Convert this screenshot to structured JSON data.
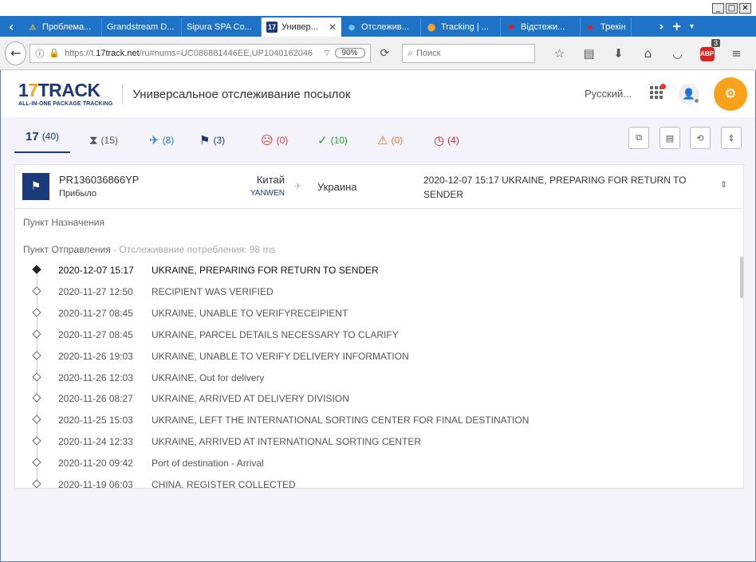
{
  "window": {
    "minimize": "_",
    "maximize": "□",
    "close": "✕"
  },
  "tabs": [
    {
      "label": "Проблема...",
      "icon": "⚠",
      "icon_color": "#f0c419"
    },
    {
      "label": "Grandstream D...",
      "icon": "",
      "icon_color": ""
    },
    {
      "label": "Sipura SPA Co...",
      "icon": "",
      "icon_color": ""
    },
    {
      "label": "Универ...",
      "icon": "17",
      "icon_color": "#1a3a7a",
      "active": true
    },
    {
      "label": "Отслежив...",
      "icon": "◉",
      "icon_color": "#7fd0ff"
    },
    {
      "label": "Tracking | ...",
      "icon": "⬤",
      "icon_color": "#f5a623"
    },
    {
      "label": "Відстежи...",
      "icon": "✱",
      "icon_color": "#e02020"
    },
    {
      "label": "Трекінг",
      "icon": "▶",
      "icon_color": "#e02020"
    }
  ],
  "tab_controls": {
    "prev": "‹",
    "next": "›",
    "new_tab": "+",
    "menu": "▾"
  },
  "navbar": {
    "back": "←",
    "url_prefix": "https://t.",
    "url_host": "17track.net",
    "url_rest": "/ru#nums=UC086881446EE,UP1040162046",
    "zoom": "90%",
    "search_placeholder": "Поиск",
    "abp_label": "ABP",
    "abp_count": "3"
  },
  "header": {
    "logo_mark": "17TRACK",
    "logo_sub": "ALL-IN-ONE PACKAGE TRACKING",
    "title": "Универсальное отслеживание посылок",
    "language": "Русский..."
  },
  "filters": [
    {
      "name": "all",
      "count": "(40)",
      "color": "#1a3a7a"
    },
    {
      "name": "not-found",
      "count": "(15)",
      "color": "#555555"
    },
    {
      "name": "in-transit",
      "count": "(8)",
      "color": "#2a7fd4"
    },
    {
      "name": "pick-up",
      "count": "(3)",
      "color": "#1a3a7a"
    },
    {
      "name": "undelivered",
      "count": "(0)",
      "color": "#e03a3a"
    },
    {
      "name": "delivered",
      "count": "(10)",
      "color": "#2a9a3a"
    },
    {
      "name": "alert",
      "count": "(0)",
      "color": "#f07a1a"
    },
    {
      "name": "expired",
      "count": "(4)",
      "color": "#c02a2a"
    }
  ],
  "package": {
    "number": "PR136036866YP",
    "status": "Прибыло",
    "origin": "Китай",
    "carrier": "YANWEN",
    "destination": "Украина",
    "latest_event": "2020-12-07 15:17 UKRAINE, PREPARING FOR RETURN TO SENDER"
  },
  "sections": {
    "destination_label": "Пункт Назначения",
    "origin_label": "Пункт Отправления",
    "origin_note": " - Отслеживание потребления: 98 ms"
  },
  "events": [
    {
      "time": "2020-12-07 15:17",
      "desc": "UKRAINE, PREPARING FOR RETURN TO SENDER"
    },
    {
      "time": "2020-11-27 12:50",
      "desc": "RECIPIENT WAS VERIFIED"
    },
    {
      "time": "2020-11-27 08:45",
      "desc": "UKRAINE, UNABLE TO VERIFYRECEIPIENT"
    },
    {
      "time": "2020-11-27 08:45",
      "desc": "UKRAINE, PARCEL DETAILS NECESSARY TO CLARIFY"
    },
    {
      "time": "2020-11-26 19:03",
      "desc": "UKRAINE, UNABLE TO VERIFY DELIVERY INFORMATION"
    },
    {
      "time": "2020-11-26 12:03",
      "desc": "UKRAINE, Out for delivery"
    },
    {
      "time": "2020-11-26 08:27",
      "desc": "UKRAINE, ARRIVED AT DELIVERY DIVISION"
    },
    {
      "time": "2020-11-25 15:03",
      "desc": "UKRAINE, LEFT THE INTERNATIONAL SORTING CENTER FOR FINAL DESTINATION"
    },
    {
      "time": "2020-11-24 12:33",
      "desc": "UKRAINE, ARRIVED AT INTERNATIONAL SORTING CENTER"
    },
    {
      "time": "2020-11-20 09:42",
      "desc": "Port of destination - Arrival"
    },
    {
      "time": "2020-11-19 06:03",
      "desc": "CHINA, REGISTER COLLECTED"
    }
  ],
  "colors": {
    "brand": "#1a3a7a",
    "accent": "#f7a21b",
    "tabstrip": "#1e73c7"
  }
}
